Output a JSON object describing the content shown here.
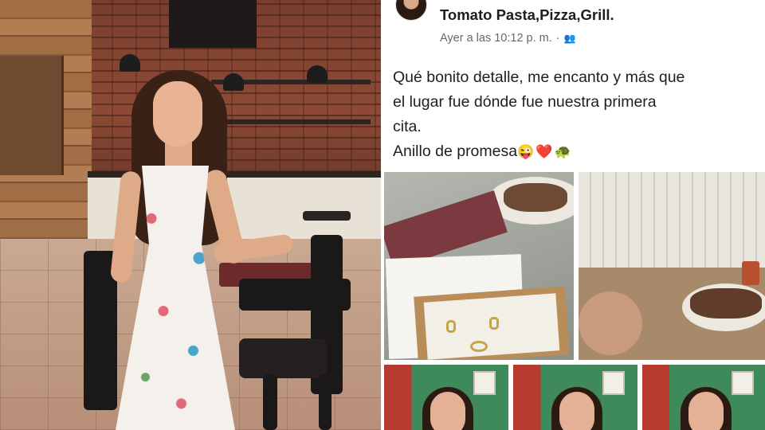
{
  "left_photo": {
    "description_icon": "restaurant-photo"
  },
  "post": {
    "page_name": "Tomato Pasta,Pizza,Grill.",
    "timestamp": "Ayer a las 10:12 p. m.",
    "separator": "·",
    "audience_icon": "friends-icon",
    "text_lines": [
      "Qué bonito detalle, me encanto y más que",
      "el lugar fue dónde fue nuestra primera",
      "cita.",
      "Anillo de promesa"
    ],
    "emojis": [
      "😜",
      "❤️",
      "🐢"
    ]
  },
  "colors": {
    "name_text": "#1c1e21",
    "meta_text": "#65676b"
  }
}
